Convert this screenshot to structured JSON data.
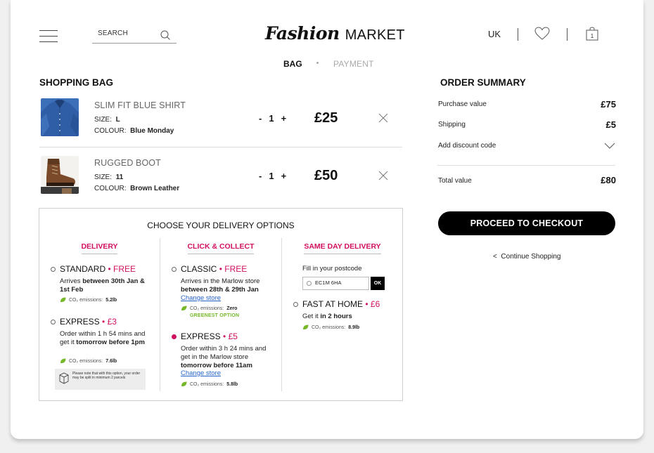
{
  "header": {
    "search_placeholder": "SEARCH",
    "logo_script": "Fashion",
    "logo_text": "MARKET",
    "country": "UK",
    "bag_count": "1"
  },
  "steps": {
    "bag": "BAG",
    "payment": "PAYMENT"
  },
  "bag": {
    "title": "SHOPPING BAG",
    "size_label": "SIZE:",
    "colour_label": "COLOUR:",
    "items": [
      {
        "name": "SLIM FIT BLUE SHIRT",
        "size": "L",
        "colour": "Blue Monday",
        "minus": "-",
        "qty": "1",
        "plus": "+",
        "price": "£25",
        "image": "blue-shirt-photo"
      },
      {
        "name": "RUGGED BOOT",
        "size": "11",
        "colour": "Brown Leather",
        "minus": "-",
        "qty": "1",
        "plus": "+",
        "price": "£50",
        "image": "brown-boot-photo"
      }
    ]
  },
  "delivery": {
    "title": "CHOOSE YOUR DELIVERY OPTIONS",
    "columns": [
      {
        "title": "DELIVERY",
        "options": [
          {
            "name": "STANDARD",
            "sep": " • ",
            "price": "FREE",
            "desc_plain": "Arrives ",
            "desc_bold": "between 30th Jan & 1st Feb",
            "co2_label": "CO₂ emissions:",
            "co2_value": "5.2lb",
            "selected": false
          },
          {
            "name": "EXPRESS",
            "sep": " • ",
            "price": "£3",
            "desc_plain": "Order within 1 h 54 mins and get it ",
            "desc_bold": "tomorrow before 1pm",
            "co2_label": "CO₂ emissions:",
            "co2_value": "7.6lb",
            "selected": false
          }
        ],
        "note": "Please note that with this option, your order may be split in minimum 2 parcels"
      },
      {
        "title": "CLICK & COLLECT",
        "options": [
          {
            "name": "CLASSIC",
            "sep": " • ",
            "price": "FREE",
            "desc_plain": "Arrives in the Marlow store ",
            "desc_bold": "between 28th & 29th Jan",
            "link": "Change store",
            "co2_label": "CO₂ emissions:",
            "co2_value": "Zero",
            "badge": "GREENEST OPTION",
            "selected": false
          },
          {
            "name": "EXPRESS",
            "sep": " • ",
            "price": "£5",
            "desc_plain": "Order within 3 h 24 mins and get in the Marlow store ",
            "desc_bold": "tomorrow before 11am",
            "link": "Change store",
            "co2_label": "CO₂ emissions:",
            "co2_value": "5.8lb",
            "selected": true
          }
        ]
      },
      {
        "title": "SAME DAY DELIVERY",
        "postcode_label": "Fill in your postcode",
        "postcode_value": "EC1M 6HA",
        "ok": "OK",
        "options": [
          {
            "name": "FAST AT HOME",
            "sep": " • ",
            "price": "£6",
            "desc_plain": "Get it ",
            "desc_bold": "in 2 hours",
            "co2_label": "CO₂ emissions:",
            "co2_value": "8.9lb",
            "selected": false
          }
        ]
      }
    ]
  },
  "summary": {
    "title": "ORDER SUMMARY",
    "purchase_label": "Purchase value",
    "purchase_value": "£75",
    "shipping_label": "Shipping",
    "shipping_value": "£5",
    "discount_label": "Add discount code",
    "total_label": "Total value",
    "total_value": "£80",
    "checkout": "PROCEED TO CHECKOUT",
    "continue_arrow": "<",
    "continue": "Continue Shopping"
  },
  "colors": {
    "accent": "#d1105f",
    "green": "#77b82a",
    "link": "#2563c9"
  }
}
